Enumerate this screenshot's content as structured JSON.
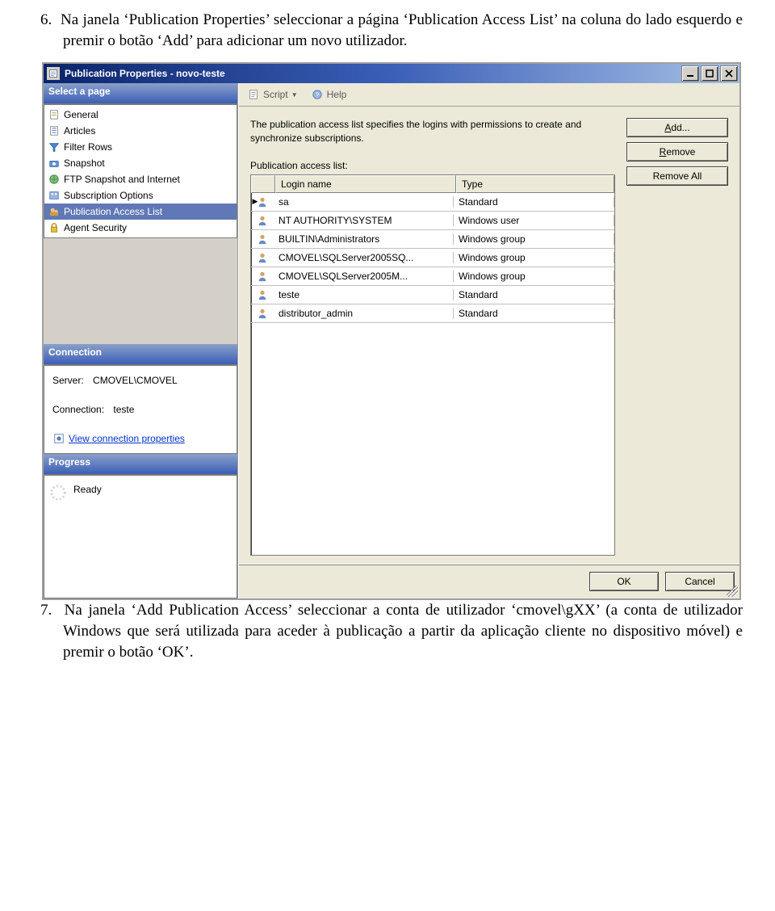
{
  "doc": {
    "para6": "6.  Na janela ‘Publication Properties’ seleccionar a página ‘Publication Access List’ na coluna do lado esquerdo e premir o botão ‘Add’ para adicionar um novo utilizador.",
    "para7": "7.  Na janela ‘Add Publication Access’ seleccionar a conta de utilizador ‘cmovel\\gXX’ (a conta de utilizador Windows que será utilizada para aceder à publicação a partir da aplicação cliente no dispositivo móvel) e premir o botão ‘OK’."
  },
  "window": {
    "title": "Publication Properties - novo-teste",
    "select_page": "Select a page",
    "pages": [
      "General",
      "Articles",
      "Filter Rows",
      "Snapshot",
      "FTP Snapshot and Internet",
      "Subscription Options",
      "Publication Access List",
      "Agent Security"
    ],
    "selected_page_index": 6,
    "connection_header": "Connection",
    "server_label": "Server:",
    "server_value": "CMOVEL\\CMOVEL",
    "connection_label": "Connection:",
    "connection_value": "teste",
    "view_conn_props": "View connection properties",
    "progress_header": "Progress",
    "progress_status": "Ready",
    "toolbar": {
      "script": "Script",
      "help": "Help"
    },
    "desc": "The publication access list specifies the logins with permissions to create and synchronize subscriptions.",
    "list_label": "Publication access list:",
    "columns": {
      "login": "Login name",
      "type": "Type"
    },
    "rows": [
      {
        "login": "sa",
        "type": "Standard"
      },
      {
        "login": "NT AUTHORITY\\SYSTEM",
        "type": "Windows user"
      },
      {
        "login": "BUILTIN\\Administrators",
        "type": "Windows group"
      },
      {
        "login": "CMOVEL\\SQLServer2005SQ...",
        "type": "Windows group"
      },
      {
        "login": "CMOVEL\\SQLServer2005M...",
        "type": "Windows group"
      },
      {
        "login": "teste",
        "type": "Standard"
      },
      {
        "login": "distributor_admin",
        "type": "Standard"
      }
    ],
    "buttons": {
      "add": "Add...",
      "remove": "Remove",
      "remove_all": "Remove All"
    },
    "ok": "OK",
    "cancel": "Cancel"
  }
}
